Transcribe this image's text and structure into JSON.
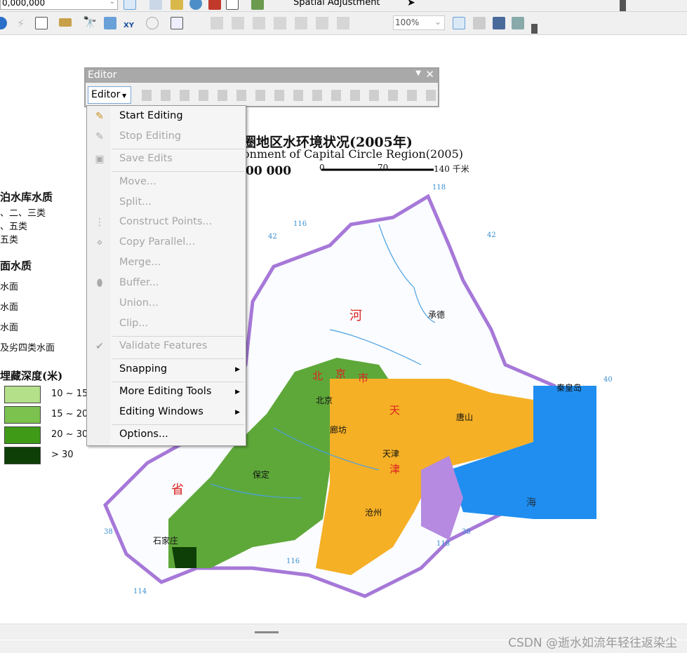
{
  "toolbar1": {
    "scale_value": "0,000,000",
    "spatial_adjustment_label": "Spatial Adjustment"
  },
  "toolbar2": {
    "zoom_value": "100%"
  },
  "editor_window": {
    "title": "Editor",
    "editor_dropdown": "Editor"
  },
  "editor_menu": {
    "items": [
      {
        "label": "Start Editing",
        "enabled": true
      },
      {
        "label": "Stop Editing",
        "enabled": false
      },
      {
        "label": "Save Edits",
        "enabled": false
      },
      {
        "label": "Move...",
        "enabled": false
      },
      {
        "label": "Split...",
        "enabled": false
      },
      {
        "label": "Construct Points...",
        "enabled": false
      },
      {
        "label": "Copy Parallel...",
        "enabled": false
      },
      {
        "label": "Merge...",
        "enabled": false
      },
      {
        "label": "Buffer...",
        "enabled": false
      },
      {
        "label": "Union...",
        "enabled": false
      },
      {
        "label": "Clip...",
        "enabled": false
      },
      {
        "label": "Validate Features",
        "enabled": false
      },
      {
        "label": "Snapping",
        "enabled": true
      },
      {
        "label": "More Editing Tools",
        "enabled": true
      },
      {
        "label": "Editing Windows",
        "enabled": true
      },
      {
        "label": "Options...",
        "enabled": true
      }
    ]
  },
  "map": {
    "title_cn": "圈地区水环境状况(2005年)",
    "title_en": "onment of Capital Circle Region(2005)",
    "scale": "00 000",
    "scalebar": [
      "0",
      "70",
      "140 千米"
    ],
    "legend": {
      "lake_title": "泊水库水质",
      "lake_items": [
        "、二、三类",
        "、五类",
        "五类"
      ],
      "surface_title": "面水质",
      "surface_items": [
        "水面",
        "水面",
        "水面",
        "及劣四类水面"
      ],
      "depth_title": "埋藏深度(米)",
      "depth_items": [
        "10 ~ 15",
        "15 ~ 20",
        "20 ~ 30",
        "> 30"
      ],
      "depth_colors": [
        "#b5e08a",
        "#7cc24e",
        "#3f9a18",
        "#0d3f06"
      ]
    },
    "places": [
      "承德",
      "秦皇岛",
      "北京",
      "天津",
      "唐山",
      "廊坊",
      "保定",
      "沧州",
      "石家庄",
      "河",
      "北",
      "京",
      "市",
      "天",
      "津",
      "省",
      "海"
    ],
    "gridlabels": [
      "118",
      "116",
      "42",
      "42",
      "40",
      "38",
      "38",
      "116",
      "118",
      "114"
    ]
  },
  "watermark": "CSDN @逝水如流年轻往返染尘"
}
